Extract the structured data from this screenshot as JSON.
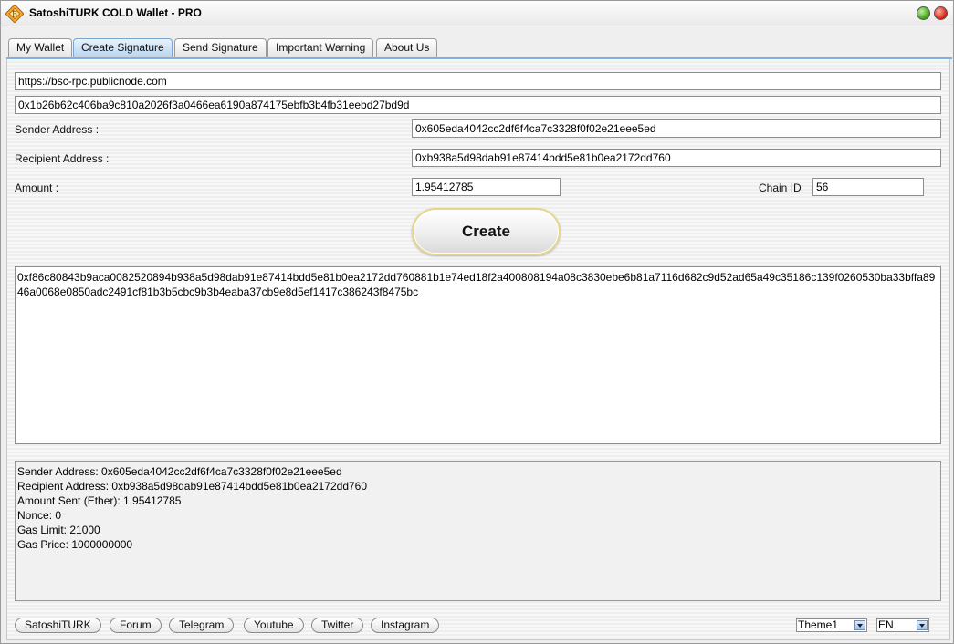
{
  "window": {
    "title": "SatoshiTURK COLD Wallet - PRO"
  },
  "tabs": [
    {
      "label": "My Wallet"
    },
    {
      "label": "Create Signature"
    },
    {
      "label": "Send Signature"
    },
    {
      "label": "Important Warning"
    },
    {
      "label": "About Us"
    }
  ],
  "form": {
    "rpc_url": "https://bsc-rpc.publicnode.com",
    "private_key": "0x1b26b62c406ba9c810a2026f3a0466ea6190a874175ebfb3b4fb31eebd27bd9d",
    "sender_label": "Sender Address :",
    "sender_value": "0x605eda4042cc2df6f4ca7c3328f0f02e21eee5ed",
    "recipient_label": "Recipient Address :",
    "recipient_value": "0xb938a5d98dab91e87414bdd5e81b0ea2172dd760",
    "amount_label": "Amount :",
    "amount_value": "1.95412785",
    "chain_label": "Chain ID",
    "chain_value": "56",
    "create_label": "Create"
  },
  "signature": {
    "text": "0xf86c80843b9aca0082520894b938a5d98dab91e87414bdd5e81b0ea2172dd760881b1e74ed18f2a400808194a08c3830ebe6b81a7116d682c9d52ad65a49c35186c139f0260530ba33bffa8946a0068e0850adc2491cf81b3b5cbc9b3b4eaba37cb9e8d5ef1417c386243f8475bc"
  },
  "info": {
    "lines": [
      "Sender Address: 0x605eda4042cc2df6f4ca7c3328f0f02e21eee5ed",
      "Recipient Address: 0xb938a5d98dab91e87414bdd5e81b0ea2172dd760",
      "Amount Sent (Ether): 1.95412785",
      "Nonce: 0",
      "Gas Limit: 21000",
      "Gas Price: 1000000000"
    ]
  },
  "footer": {
    "links": [
      {
        "label": "SatoshiTURK"
      },
      {
        "label": "Forum"
      },
      {
        "label": "Telegram"
      },
      {
        "label": "Youtube"
      },
      {
        "label": "Twitter"
      },
      {
        "label": "Instagram"
      }
    ],
    "theme_value": "Theme1",
    "language_value": "EN"
  },
  "colors": {
    "tab_accent": "#7fb0de",
    "create_border": "#e7d58a"
  },
  "icons": {
    "app": "wallet-diamond-icon",
    "maximize": "green-circle-icon",
    "close": "red-circle-icon",
    "dropdown": "chevron-down-icon"
  }
}
